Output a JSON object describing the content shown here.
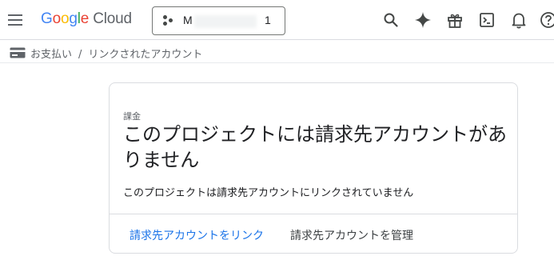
{
  "header": {
    "logo": {
      "letters": [
        "G",
        "o",
        "o",
        "g",
        "l",
        "e"
      ],
      "letter_colors": [
        "#4285F4",
        "#EA4335",
        "#FBBC05",
        "#4285F4",
        "#34A853",
        "#EA4335"
      ],
      "suffix": "Cloud"
    },
    "project": {
      "prefix": "M",
      "suffix": "1"
    },
    "icons": [
      "menu-icon",
      "search-icon",
      "gemini-icon",
      "gift-icon",
      "cloud-shell-icon",
      "notifications-icon",
      "help-icon"
    ]
  },
  "breadcrumb": {
    "items": [
      "お支払い",
      "リンクされたアカウント"
    ],
    "separator": "/"
  },
  "card": {
    "eyebrow": "課金",
    "title": "このプロジェクトには請求先アカウントがありません",
    "description": "このプロジェクトは請求先アカウントにリンクされていません",
    "actions": {
      "link": "請求先アカウントをリンク",
      "manage": "請求先アカウントを管理"
    }
  },
  "colors": {
    "accent": "#1a73e8",
    "text": "#202124",
    "muted": "#5f6368",
    "border": "#dadce0"
  }
}
